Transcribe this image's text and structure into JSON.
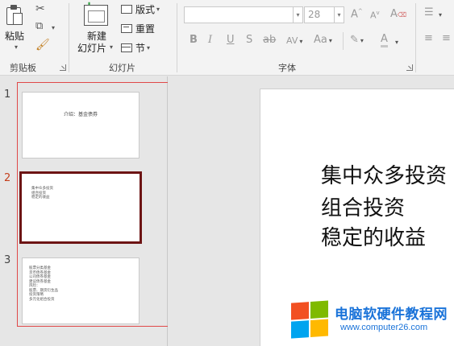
{
  "ribbon": {
    "clipboard": {
      "paste_label": "粘贴",
      "group_label": "剪贴板"
    },
    "slides": {
      "new_slide_line1": "新建",
      "new_slide_line2": "幻灯片",
      "layout_label": "版式",
      "reset_label": "重置",
      "section_label": "节",
      "group_label": "幻灯片"
    },
    "font": {
      "font_name_value": "",
      "font_size_value": "28",
      "bold": "B",
      "italic": "I",
      "underline": "U",
      "shadow": "S",
      "strikethrough": "ab",
      "spacing": "AV",
      "change_case": "Aa",
      "grow": "A",
      "shrink": "A",
      "clear": "A",
      "font_color": "A",
      "group_label": "字体"
    }
  },
  "thumbnails": [
    {
      "number": "1",
      "title": "介绍：基金债券",
      "lines": []
    },
    {
      "number": "2",
      "title": "",
      "lines": [
        "集中众多投资",
        "组合投资",
        "稳定的收益"
      ]
    },
    {
      "number": "3",
      "title": "",
      "lines": [
        "股票分类基金",
        "货币债券基金",
        "公司债券基金",
        "建议债券基金",
        "风险：",
        "股票、期货衍生品",
        "投资策略",
        "多元化组合投资"
      ]
    }
  ],
  "current_slide": {
    "body_lines": [
      "集中众多投资",
      "组合投资",
      "稳定的收益"
    ]
  },
  "watermark": {
    "title": "电脑软硬件教程网",
    "url": "www.computer26.com"
  },
  "colors": {
    "selected_thumb_border": "#6d1414",
    "active_number": "#c43e1c",
    "watermark_blue": "#1a73d9"
  }
}
